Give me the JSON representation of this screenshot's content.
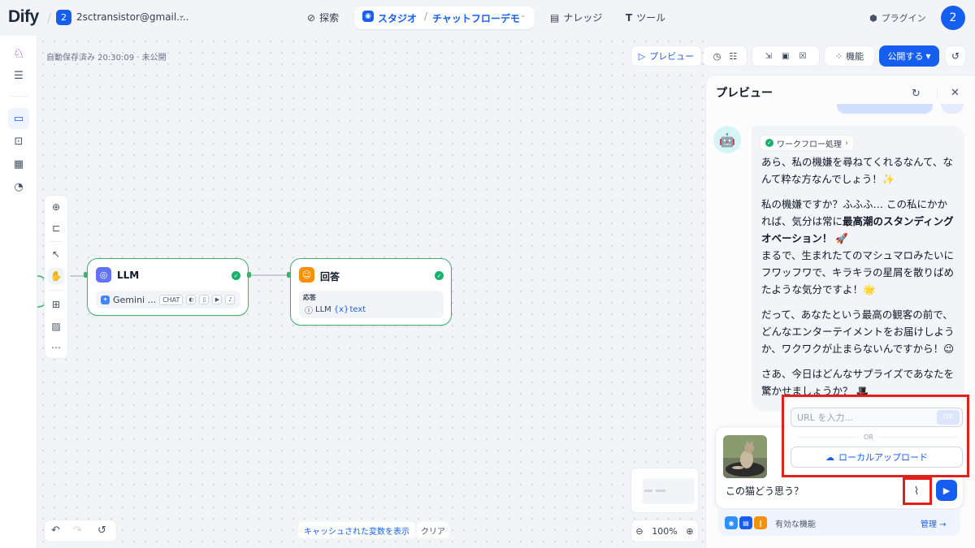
{
  "header": {
    "logo": "Dify",
    "workspace_badge": "2",
    "workspace_name": "2sctransistor@gmail....",
    "nav": {
      "explore": "探索",
      "studio": "スタジオ",
      "app_name": "チャットフローデモ",
      "knowledge": "ナレッジ",
      "tools": "ツール"
    },
    "plugins": "プラグイン",
    "avatar": "2"
  },
  "canvas": {
    "autosave": "自動保存済み 20:30:09 · 未公開",
    "toolbar": {
      "preview": "プレビュー",
      "features": "機能",
      "publish": "公開する"
    },
    "nodes": {
      "llm": {
        "title": "LLM",
        "model": "Gemini ...",
        "mode_tag": "CHAT"
      },
      "answer": {
        "title": "回答",
        "field_label": "応答",
        "var_source": "LLM",
        "var_name": "text"
      }
    },
    "cache_button": "キャッシュされた変数を表示",
    "clear_button": "クリア",
    "zoom": "100%"
  },
  "preview": {
    "title": "プレビュー",
    "workflow_badge": "ワークフロー処理",
    "message": {
      "p1": "あら、私の機嫌を尋ねてくれるなんて、なんて粋な方なんでしょう！✨",
      "p2_a": "私の機嫌ですか？ふふふ… この私にかかれば、気分は常に",
      "p2_bold": "最高潮のスタンディングオベーション！",
      "p2_b": " 🚀",
      "p2_c": "まるで、生まれたてのマシュマロみたいにフワッフワで、キラキラの星屑を散りばめたような気分ですよ！🌟",
      "p3": "だって、あなたという最高の観客の前で、どんなエンターテイメントをお届けしようか、ワクワクが止まらないんですから！😉",
      "p4": "さあ、今日はどんなサプライズであなたを驚かせましょうか？ 🎩"
    },
    "input_text": "この猫どう思う？",
    "upload": {
      "url_placeholder": "URL を入力...",
      "ok": "OK",
      "or": "OR",
      "local_upload": "ローカルアップロード"
    },
    "features_text": "有効な機能",
    "manage": "管理 →"
  }
}
